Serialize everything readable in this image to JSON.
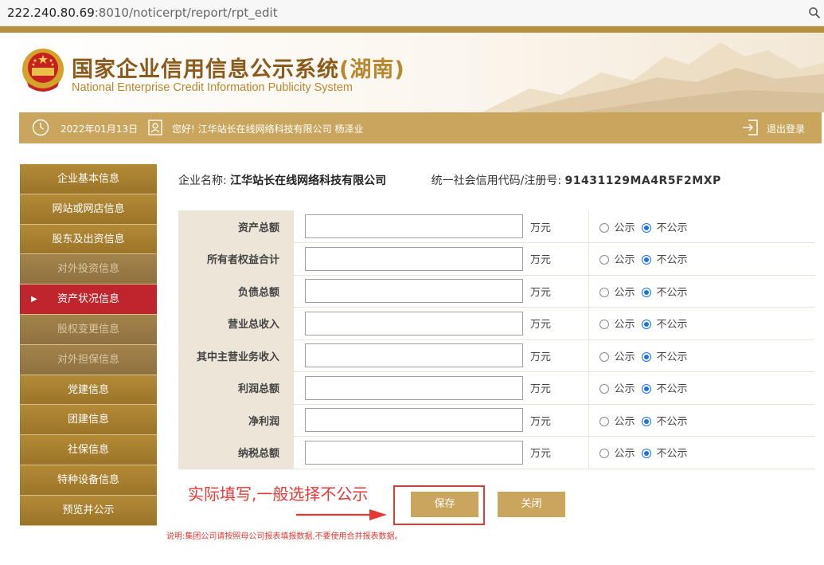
{
  "browser": {
    "url_host": "222.240.80.69",
    "url_path": ":8010/noticerpt/report/rpt_edit",
    "search_icon": "search-icon"
  },
  "header": {
    "title_cn": "国家企业信用信息公示系统",
    "title_province": "(湖南)",
    "title_en": "National Enterprise Credit Information Publicity System",
    "brand_color": "#8c5a1a",
    "accent_color": "#b8882f"
  },
  "infobar": {
    "date": "2022年01月13日",
    "greeting": "您好!  江华站长在线网络科技有限公司   杨泽业",
    "logout": "退出登录",
    "background": "#c9a55d"
  },
  "sidebar": {
    "items": [
      {
        "label": "企业基本信息",
        "state": "normal"
      },
      {
        "label": "网站或网店信息",
        "state": "normal"
      },
      {
        "label": "股东及出资信息",
        "state": "normal"
      },
      {
        "label": "对外投资信息",
        "state": "disabled"
      },
      {
        "label": "资产状况信息",
        "state": "active"
      },
      {
        "label": "股权变更信息",
        "state": "disabled"
      },
      {
        "label": "对外担保信息",
        "state": "disabled"
      },
      {
        "label": "党建信息",
        "state": "normal"
      },
      {
        "label": "团建信息",
        "state": "normal"
      },
      {
        "label": "社保信息",
        "state": "normal"
      },
      {
        "label": "特种设备信息",
        "state": "normal"
      },
      {
        "label": "预览并公示",
        "state": "normal"
      }
    ],
    "active_arrow": "▶",
    "active_color": "#c0252b"
  },
  "company": {
    "name_label": "企业名称:",
    "name": "江华站长在线网络科技有限公司",
    "code_label": "统一社会信用代码/注册号:",
    "code": "91431129MA4R5F2MXP"
  },
  "form": {
    "unit": "万元",
    "option_public": "公示",
    "option_private": "不公示",
    "rows": [
      {
        "label": "资产总额",
        "value": "",
        "selected": "不公示"
      },
      {
        "label": "所有者权益合计",
        "value": "",
        "selected": "不公示"
      },
      {
        "label": "负债总额",
        "value": "",
        "selected": "不公示"
      },
      {
        "label": "营业总收入",
        "value": "",
        "selected": "不公示"
      },
      {
        "label": "其中主营业务收入",
        "value": "",
        "selected": "不公示"
      },
      {
        "label": "利润总额",
        "value": "",
        "selected": "不公示"
      },
      {
        "label": "净利润",
        "value": "",
        "selected": "不公示"
      },
      {
        "label": "纳税总额",
        "value": "",
        "selected": "不公示"
      }
    ]
  },
  "annotation": {
    "text": "实际填写,一般选择不公示",
    "color": "#e53935"
  },
  "buttons": {
    "save": "保存",
    "close": "关闭"
  },
  "footnote": "说明:集团公司请按照母公司报表填报数据,不要使用合并报表数据。"
}
